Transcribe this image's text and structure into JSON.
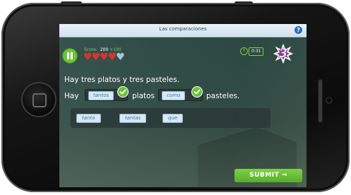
{
  "app": {
    "title": "Las comparaciones",
    "help_label": "?"
  },
  "status": {
    "score_label": "Score:",
    "score_value": "200",
    "score_bonus": "+100",
    "hearts_total": 5,
    "hearts_remaining": 4,
    "timer": "0:31",
    "streak": "3"
  },
  "question": {
    "sentence": "Hay tres platos y tres pasteles.",
    "parts": {
      "word_1": "Hay",
      "blank_1_answer": "tantos",
      "word_2": "platos",
      "blank_2_answer": "como",
      "word_3": "pasteles."
    }
  },
  "word_bank": {
    "options": [
      "tanto",
      "tantas",
      "que"
    ]
  },
  "actions": {
    "submit_label": "SUBMIT →"
  },
  "colors": {
    "accent_green": "#6fc23a",
    "heart_red": "#e0312d",
    "heart_empty": "#a9c6d8",
    "chip_text_blue": "#3a78b0"
  }
}
